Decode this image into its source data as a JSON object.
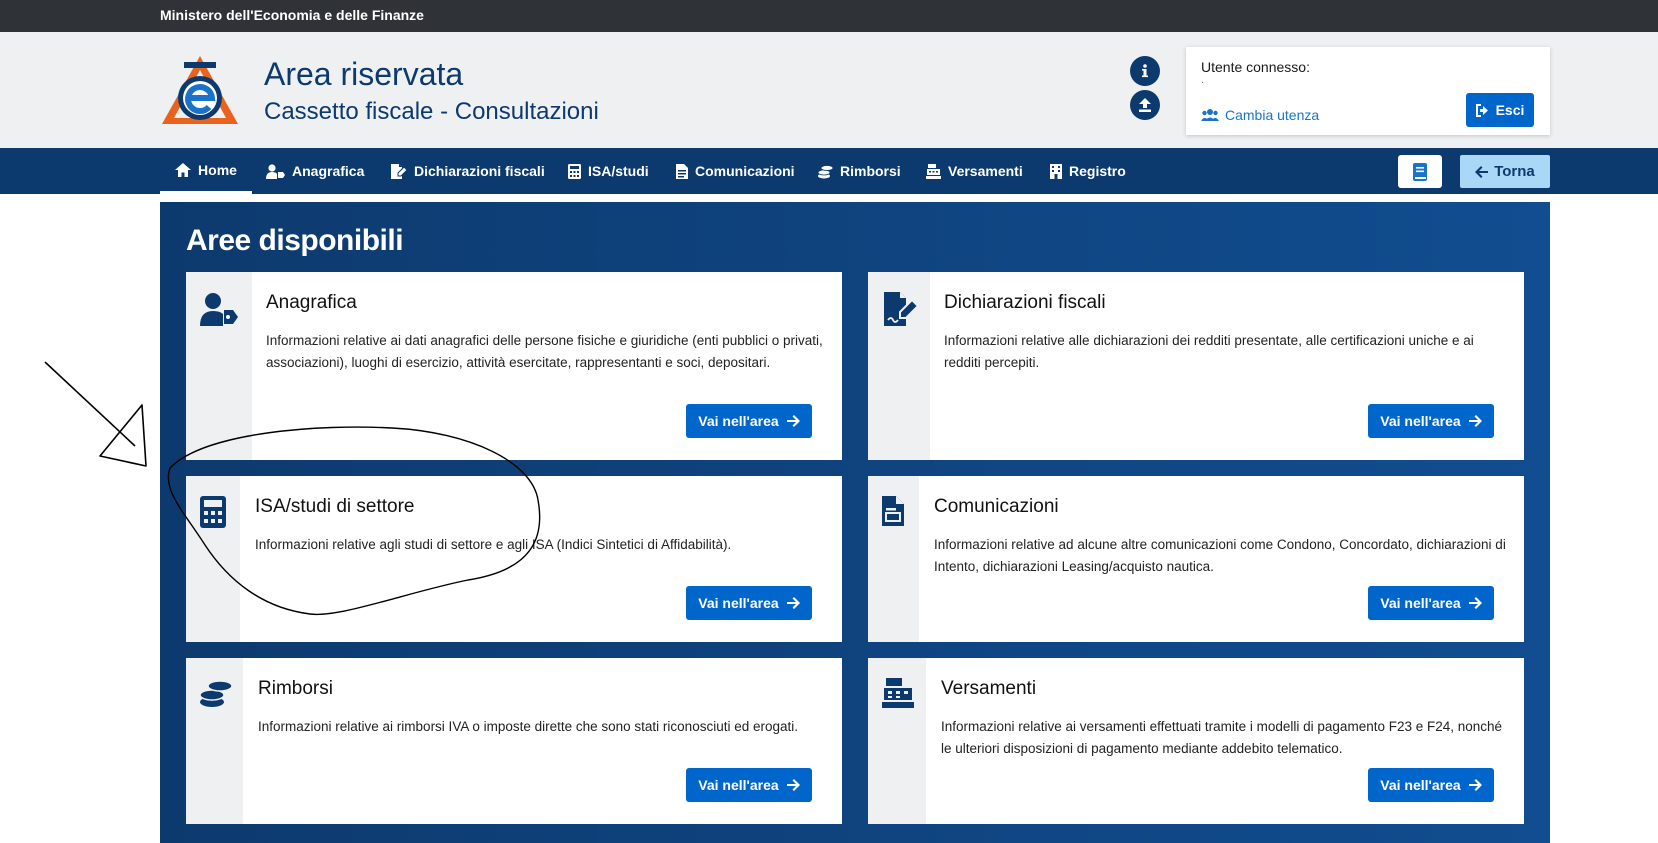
{
  "topbar": {
    "ministry": "Ministero dell'Economia e delle Finanze"
  },
  "header": {
    "title": "Area riservata",
    "subtitle": "Cassetto fiscale - Consultazioni",
    "user_label": "Utente connesso:",
    "change_user": "Cambia utenza",
    "logout": "Esci"
  },
  "nav": {
    "items": [
      {
        "label": "Home",
        "icon": "home-icon"
      },
      {
        "label": "Anagrafica",
        "icon": "user-tag-icon"
      },
      {
        "label": "Dichiarazioni fiscali",
        "icon": "file-signature-icon"
      },
      {
        "label": "ISA/studi",
        "icon": "calculator-icon"
      },
      {
        "label": "Comunicazioni",
        "icon": "document-icon"
      },
      {
        "label": "Rimborsi",
        "icon": "coins-icon"
      },
      {
        "label": "Versamenti",
        "icon": "cash-register-icon"
      },
      {
        "label": "Registro",
        "icon": "building-icon"
      }
    ],
    "back": "Torna"
  },
  "main": {
    "title": "Aree disponibili",
    "cards": [
      {
        "title": "Anagrafica",
        "desc": "Informazioni relative ai dati anagrafici delle persone fisiche e giuridiche (enti pubblici o privati, associazioni), luoghi di esercizio, attività esercitate, rappresentanti e soci, depositari.",
        "button": "Vai nell'area"
      },
      {
        "title": "Dichiarazioni fiscali",
        "desc": "Informazioni relative alle dichiarazioni dei redditi presentate, alle certificazioni uniche e ai redditi percepiti.",
        "button": "Vai nell'area"
      },
      {
        "title": "ISA/studi di settore",
        "desc": "Informazioni relative agli studi di settore e agli ISA (Indici Sintetici di Affidabilità).",
        "button": "Vai nell'area"
      },
      {
        "title": "Comunicazioni",
        "desc": "Informazioni relative ad alcune altre comunicazioni come Condono, Concordato, dichiarazioni di Intento, dichiarazioni Leasing/acquisto nautica.",
        "button": "Vai nell'area"
      },
      {
        "title": "Rimborsi",
        "desc": "Informazioni relative ai rimborsi IVA o imposte dirette che sono stati riconosciuti ed erogati.",
        "button": "Vai nell'area"
      },
      {
        "title": "Versamenti",
        "desc": "Informazioni relative ai versamenti effettuati tramite i modelli di pagamento F23 e F24, nonché le ulteriori disposizioni di pagamento mediante addebito telematico.",
        "button": "Vai nell'area"
      }
    ]
  },
  "colors": {
    "brand_dark": "#0d3a6e",
    "button_blue": "#0066cc",
    "link_blue": "#1a73c8",
    "back_button": "#a8d8f5"
  }
}
